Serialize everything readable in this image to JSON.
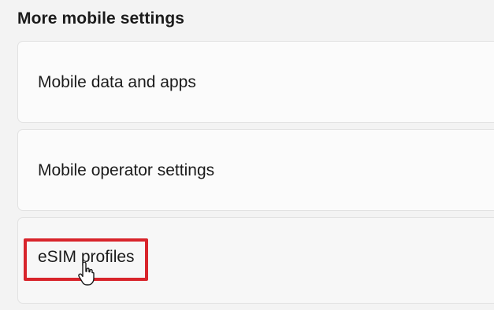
{
  "section": {
    "title": "More mobile settings"
  },
  "items": [
    {
      "label": "Mobile data and apps"
    },
    {
      "label": "Mobile operator settings"
    },
    {
      "label": "eSIM profiles"
    }
  ],
  "colors": {
    "highlight": "#d8242b",
    "background": "#f3f3f3",
    "card": "#fbfbfb"
  },
  "icons": {
    "cursor": "hand-pointer-cursor-icon"
  }
}
